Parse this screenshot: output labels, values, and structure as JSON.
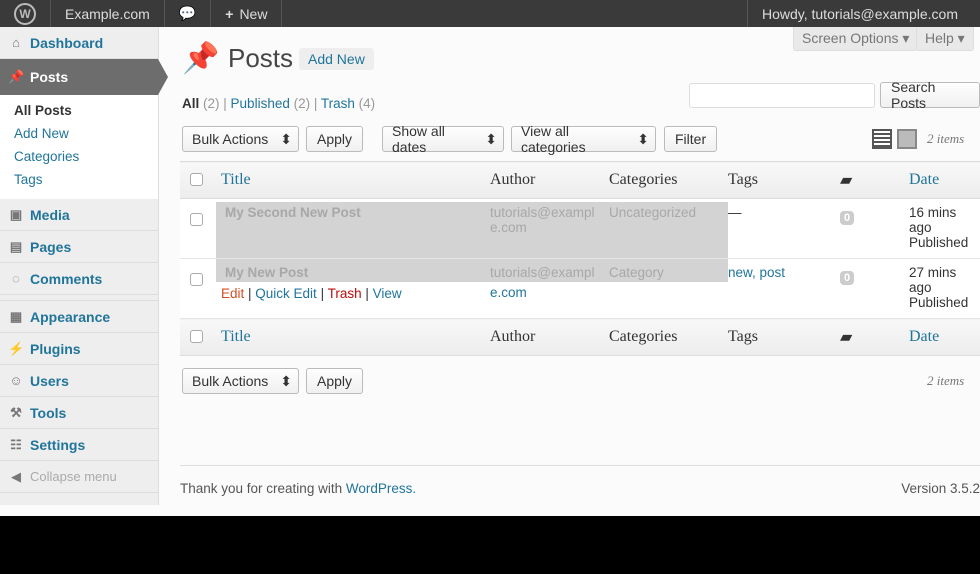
{
  "topbar": {
    "site": "Example.com",
    "new": "New",
    "howdy": "Howdy, tutorials@example.com"
  },
  "sidebar": {
    "items": [
      {
        "label": "Dashboard"
      },
      {
        "label": "Posts"
      },
      {
        "label": "Media"
      },
      {
        "label": "Pages"
      },
      {
        "label": "Comments"
      },
      {
        "label": "Appearance"
      },
      {
        "label": "Plugins"
      },
      {
        "label": "Users"
      },
      {
        "label": "Tools"
      },
      {
        "label": "Settings"
      }
    ],
    "sub": [
      "All Posts",
      "Add New",
      "Categories",
      "Tags"
    ],
    "collapse": "Collapse menu"
  },
  "screen_options": "Screen Options",
  "help": "Help",
  "title": "Posts",
  "add_new": "Add New",
  "views": {
    "all": "All",
    "all_count": "(2)",
    "published": "Published",
    "published_count": "(2)",
    "trash": "Trash",
    "trash_count": "(4)"
  },
  "search_button": "Search Posts",
  "bulk": "Bulk Actions",
  "apply": "Apply",
  "dates": "Show all dates",
  "cats": "View all categories",
  "filter": "Filter",
  "items": "2 items",
  "columns": {
    "title": "Title",
    "author": "Author",
    "categories": "Categories",
    "tags": "Tags",
    "date": "Date"
  },
  "rows": [
    {
      "title": "My Second New Post",
      "author1": "tutorials@exampl",
      "author2": "e.com",
      "category": "Uncategorized",
      "tags": "—",
      "comments": "0",
      "date1": "16 mins",
      "date2": "ago",
      "status": "Published"
    },
    {
      "title": "My New Post",
      "author1": "tutorials@exampl",
      "author2": "e.com",
      "category": "Category",
      "tags": "new, post",
      "comments": "0",
      "date1": "27 mins",
      "date2": "ago",
      "status": "Published"
    }
  ],
  "row_actions": {
    "edit": "Edit",
    "quick_edit": "Quick Edit",
    "trash": "Trash",
    "view": "View"
  },
  "footer": {
    "thanks": "Thank you for creating with ",
    "wp": "WordPress.",
    "version": "Version 3.5.2"
  }
}
